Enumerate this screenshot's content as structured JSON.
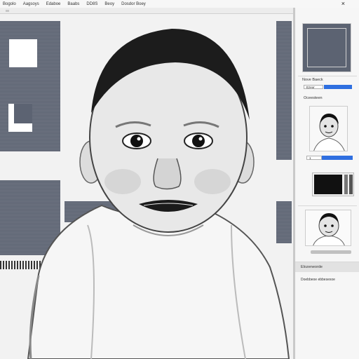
{
  "menu": {
    "items": [
      "Bogolo",
      "Aagsoys",
      "Edaboe",
      "Baabs",
      "DD8S",
      "Beoy",
      "Dosdor Boey"
    ],
    "close_icon": "×"
  },
  "canvas": {
    "image_description_icon": "photo-canvas"
  },
  "panel": {
    "section_title": "Nove Baeck",
    "field1_value": "Ezeor",
    "section2_label": "Oceesteen",
    "field2_value": "1",
    "bottom_title": "Elozeneorde",
    "bottom_caption": "Doebbeoe ebbesexoe"
  },
  "colors": {
    "accent": "#2f6fe0",
    "slate": "#5c6372"
  }
}
